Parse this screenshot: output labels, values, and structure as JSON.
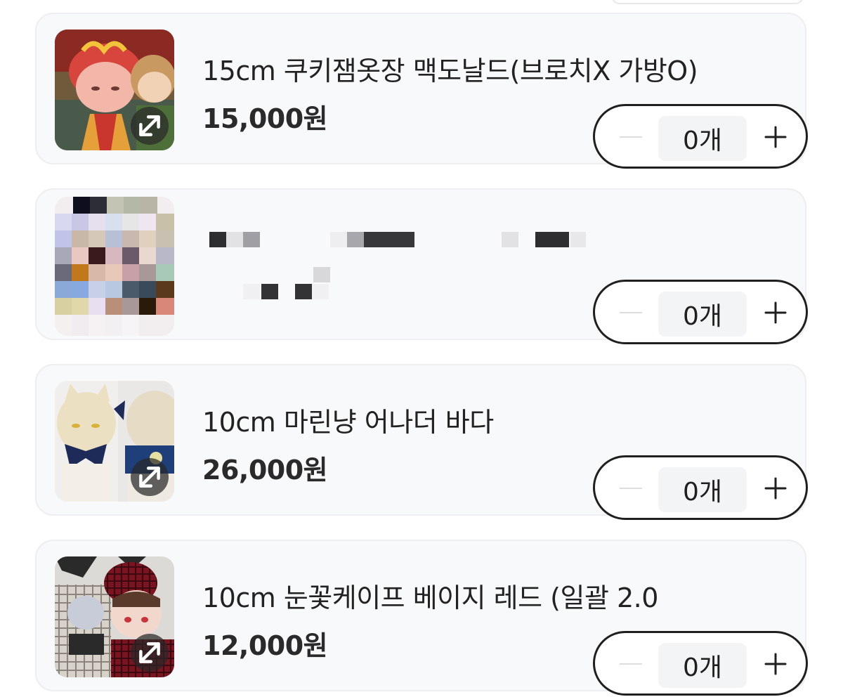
{
  "items": [
    {
      "name": "15cm 쿠키잼옷장 맥도날드(브로치X 가방O)",
      "price": "15,000원",
      "quantity": "0개",
      "image": "mcdonald-doll-outfit",
      "expand_icon": "expand-arrows-icon"
    },
    {
      "name": "",
      "price": "",
      "quantity": "0개",
      "image": "pixelated-censored",
      "censored": true
    },
    {
      "name": "10cm 마린냥 어나더 바다",
      "price": "26,000원",
      "quantity": "0개",
      "image": "marine-cat-doll-outfit",
      "expand_icon": "expand-arrows-icon"
    },
    {
      "name": "10cm 눈꽃케이프 베이지 레드 (일괄 2.0",
      "price": "12,000원",
      "quantity": "0개",
      "image": "snowflake-cape-doll-outfit",
      "expand_icon": "expand-arrows-icon"
    }
  ],
  "stepper": {
    "minus_icon": "minus-icon",
    "plus_icon": "plus-icon"
  },
  "colors": {
    "card_bg": "#f8f9fb",
    "card_border": "#eceef1",
    "stepper_border": "#1f1f1f",
    "qty_bg": "#f3f4f6"
  }
}
